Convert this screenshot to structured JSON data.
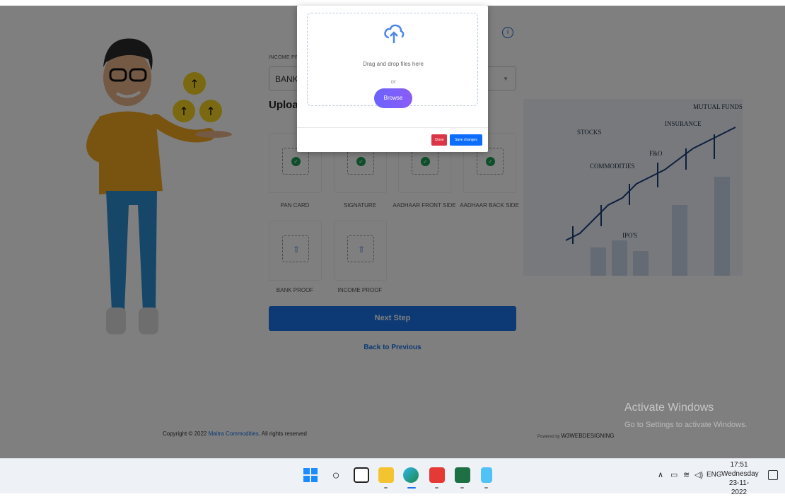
{
  "form": {
    "income_label": "INCOME PR",
    "income_select_value": "BANK",
    "upload_title": "Upload",
    "tiles": [
      {
        "label": "PAN CARD",
        "status": "uploaded"
      },
      {
        "label": "SIGNATURE",
        "status": "uploaded"
      },
      {
        "label": "AADHAAR FRONT SIDE",
        "status": "uploaded"
      },
      {
        "label": "AADHAAR BACK SIDE",
        "status": "uploaded"
      },
      {
        "label": "BANK PROOF",
        "status": "pending"
      },
      {
        "label": "INCOME PROOF",
        "status": "pending"
      }
    ],
    "next_button": "Next Step",
    "back_link": "Back to Previous"
  },
  "footer": {
    "copyright_prefix": "Copyright © 2022",
    "copyright_brand": "Maitra Commodities",
    "copyright_suffix": ". All rights reserved",
    "powered_by": "Powered by",
    "powered_by_brand": "W3WEBDESIGNING"
  },
  "chart_illustration": {
    "labels": [
      "MUTUAL FUNDS",
      "INSURANCE",
      "STOCKS",
      "F&O",
      "COMMODITIES",
      "IPO'S"
    ]
  },
  "modal": {
    "drop_text": "Drag and drop files here",
    "or_text": "or",
    "browse_label": "Browse",
    "close_label": "Close",
    "save_label": "Save changes"
  },
  "watermark": {
    "title": "Activate Windows",
    "subtitle": "Go to Settings to activate Windows."
  },
  "taskbar": {
    "apps": [
      "windows-start",
      "search",
      "task-view",
      "file-explorer",
      "edge",
      "anydesk",
      "excel",
      "notepad"
    ],
    "tray_lang": "ENG",
    "time": "17:51",
    "day": "Wednesday",
    "date": "23-11-2022"
  },
  "colors": {
    "primary": "#1a73e8",
    "success": "#1f9d55",
    "danger": "#dc3545",
    "browse_gradient_start": "#6c63ff",
    "browse_gradient_end": "#8b5cf6"
  }
}
